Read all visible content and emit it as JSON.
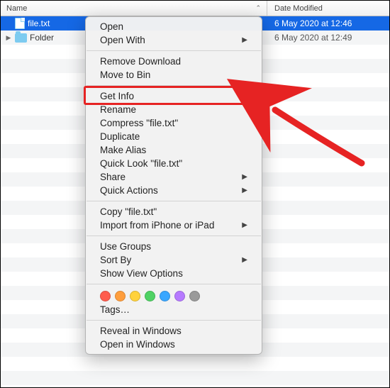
{
  "header": {
    "name_label": "Name",
    "date_label": "Date Modified"
  },
  "rows": [
    {
      "name_path": "rows.0.name",
      "name": "file.txt",
      "date_path": "rows.0.date",
      "date": "6 May 2020 at 12:46",
      "type": "file",
      "selected": true
    },
    {
      "name_path": "rows.1.name",
      "name": "Folder",
      "date_path": "rows.1.date",
      "date": "6 May 2020 at 12:49",
      "type": "folder",
      "selected": false
    }
  ],
  "menu": {
    "open": "Open",
    "open_with": "Open With",
    "remove_download": "Remove Download",
    "move_to_bin": "Move to Bin",
    "get_info": "Get Info",
    "rename": "Rename",
    "compress": "Compress \"file.txt\"",
    "duplicate": "Duplicate",
    "make_alias": "Make Alias",
    "quick_look": "Quick Look \"file.txt\"",
    "share": "Share",
    "quick_actions": "Quick Actions",
    "copy": "Copy \"file.txt\"",
    "import": "Import from iPhone or iPad",
    "use_groups": "Use Groups",
    "sort_by": "Sort By",
    "show_view_options": "Show View Options",
    "tags_label": "Tags…",
    "reveal": "Reveal in Windows",
    "open_in": "Open in Windows"
  },
  "tag_colors": [
    "#ff5c4d",
    "#ff9e3d",
    "#ffd23d",
    "#4fd264",
    "#3aa7ff",
    "#b67aff",
    "#9a9a9a"
  ]
}
